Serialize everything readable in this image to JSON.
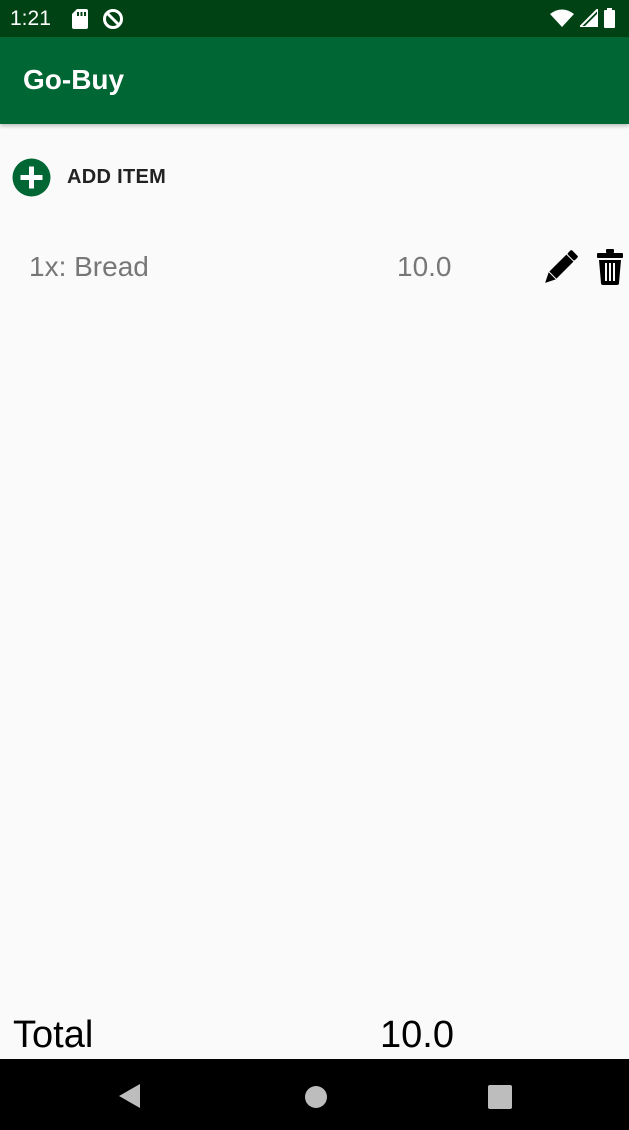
{
  "status_bar": {
    "time": "1:21",
    "left_icons": [
      "sd-card-icon",
      "data-saver-icon"
    ],
    "right_icons": [
      "wifi-icon",
      "cell-signal-icon",
      "battery-icon"
    ]
  },
  "app_bar": {
    "title": "Go-Buy",
    "color": "#006633"
  },
  "add_item": {
    "label": "ADD ITEM",
    "icon": "add-circle-icon"
  },
  "items": [
    {
      "name": "1x: Bread",
      "price": "10.0",
      "actions": [
        "pencil-icon",
        "trash-icon"
      ]
    }
  ],
  "total": {
    "label": "Total",
    "value": "10.0"
  },
  "nav_bar": {
    "buttons": [
      "back-icon",
      "home-icon",
      "recents-icon"
    ]
  }
}
